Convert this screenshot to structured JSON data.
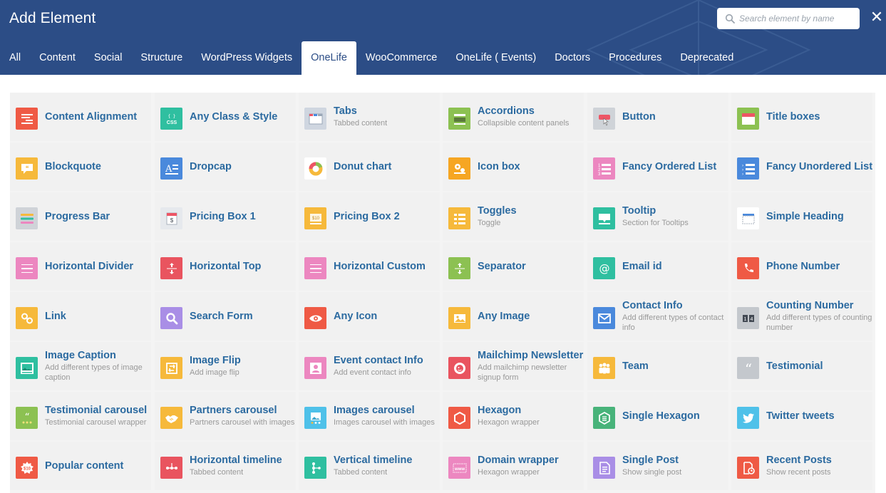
{
  "title": "Add Element",
  "search": {
    "placeholder": "Search element by name"
  },
  "close_label": "✕",
  "tabs": [
    "All",
    "Content",
    "Social",
    "Structure",
    "WordPress Widgets",
    "OneLife",
    "WooCommerce",
    "OneLife ( Events)",
    "Doctors",
    "Procedures",
    "Deprecated"
  ],
  "active_tab": "OneLife",
  "elements": [
    {
      "name": "Content Alignment",
      "desc": "",
      "icon": "align-icon",
      "color": "#ef5a45"
    },
    {
      "name": "Any Class & Style",
      "desc": "",
      "icon": "css-icon",
      "color": "#2fbfa0"
    },
    {
      "name": "Tabs",
      "desc": "Tabbed content",
      "icon": "tabs-icon",
      "color": "#cfd6e0"
    },
    {
      "name": "Accordions",
      "desc": "Collapsible content panels",
      "icon": "accordion-icon",
      "color": "#8cc152"
    },
    {
      "name": "Button",
      "desc": "",
      "icon": "button-icon",
      "color": "#cfd3d8"
    },
    {
      "name": "Title boxes",
      "desc": "",
      "icon": "title-box-icon",
      "color": "#8cc152"
    },
    {
      "name": "Blockquote",
      "desc": "",
      "icon": "quote-bubble-icon",
      "color": "#f6b93b"
    },
    {
      "name": "Dropcap",
      "desc": "",
      "icon": "dropcap-icon",
      "color": "#4a89dc"
    },
    {
      "name": "Donut chart",
      "desc": "",
      "icon": "donut-icon",
      "color": "#ffffff"
    },
    {
      "name": "Icon box",
      "desc": "",
      "icon": "gears-icon",
      "color": "#f6a623"
    },
    {
      "name": "Fancy Ordered List",
      "desc": "",
      "icon": "ordered-list-icon",
      "color": "#ec87c0"
    },
    {
      "name": "Fancy Unordered List",
      "desc": "",
      "icon": "unordered-list-icon",
      "color": "#4a89dc"
    },
    {
      "name": "Progress Bar",
      "desc": "",
      "icon": "progress-bar-icon",
      "color": "#cfd3d8"
    },
    {
      "name": "Pricing Box 1",
      "desc": "",
      "icon": "pricing-box-icon",
      "color": "#e6e9ed"
    },
    {
      "name": "Pricing Box 2",
      "desc": "",
      "icon": "price-tag-icon",
      "color": "#f6b93b"
    },
    {
      "name": "Toggles",
      "desc": "Toggle",
      "icon": "toggles-icon",
      "color": "#f6b93b"
    },
    {
      "name": "Tooltip",
      "desc": "Section for Tooltips",
      "icon": "tooltip-icon",
      "color": "#2fbfa0"
    },
    {
      "name": "Simple Heading",
      "desc": "",
      "icon": "heading-icon",
      "color": "#ffffff"
    },
    {
      "name": "Horizontal Divider",
      "desc": "",
      "icon": "divider-icon",
      "color": "#ec87c0"
    },
    {
      "name": "Horizontal Top",
      "desc": "",
      "icon": "arrows-vertical-icon",
      "color": "#e9545f"
    },
    {
      "name": "Horizontal Custom",
      "desc": "",
      "icon": "divider-icon",
      "color": "#ec87c0"
    },
    {
      "name": "Separator",
      "desc": "",
      "icon": "arrows-vertical-icon",
      "color": "#8cc152"
    },
    {
      "name": "Email id",
      "desc": "",
      "icon": "at-icon",
      "color": "#2fbfa0"
    },
    {
      "name": "Phone Number",
      "desc": "",
      "icon": "phone-icon",
      "color": "#ef5a45"
    },
    {
      "name": "Link",
      "desc": "",
      "icon": "link-icon",
      "color": "#f6b93b"
    },
    {
      "name": "Search Form",
      "desc": "",
      "icon": "search-icon",
      "color": "#a98ee6"
    },
    {
      "name": "Any Icon",
      "desc": "",
      "icon": "eye-icon",
      "color": "#ef5a45"
    },
    {
      "name": "Any Image",
      "desc": "",
      "icon": "image-icon",
      "color": "#f6b93b"
    },
    {
      "name": "Contact Info",
      "desc": "Add different types of contact info",
      "icon": "envelope-icon",
      "color": "#4a89dc"
    },
    {
      "name": "Counting Number",
      "desc": "Add different types of counting number",
      "icon": "counter-icon",
      "color": "#c4c8cd"
    },
    {
      "name": "Image Caption",
      "desc": "Add different types of image caption",
      "icon": "image-caption-icon",
      "color": "#2fbfa0"
    },
    {
      "name": "Image Flip",
      "desc": "Add image flip",
      "icon": "flip-icon",
      "color": "#f6b93b"
    },
    {
      "name": "Event contact Info",
      "desc": "Add event contact info",
      "icon": "contact-card-icon",
      "color": "#ec87c0"
    },
    {
      "name": "Mailchimp Newsletter",
      "desc": "Add mailchimp newsletter signup form",
      "icon": "mailchimp-icon",
      "color": "#e9545f"
    },
    {
      "name": "Team",
      "desc": "",
      "icon": "team-icon",
      "color": "#f6b93b"
    },
    {
      "name": "Testimonial",
      "desc": "",
      "icon": "quote-icon",
      "color": "#c4c8cd"
    },
    {
      "name": "Testimonial carousel",
      "desc": "Testimonial carousel wrapper",
      "icon": "quote-carousel-icon",
      "color": "#8cc152"
    },
    {
      "name": "Partners carousel",
      "desc": "Partners carousel with images",
      "icon": "handshake-icon",
      "color": "#f6b93b"
    },
    {
      "name": "Images carousel",
      "desc": "Images carousel with images",
      "icon": "image-carousel-icon",
      "color": "#4fc1e9"
    },
    {
      "name": "Hexagon",
      "desc": "Hexagon wrapper",
      "icon": "hexagon-icon",
      "color": "#ef5a45"
    },
    {
      "name": "Single Hexagon",
      "desc": "",
      "icon": "hexagon-lines-icon",
      "color": "#48b37a"
    },
    {
      "name": "Twitter tweets",
      "desc": "",
      "icon": "twitter-icon",
      "color": "#4fc1e9"
    },
    {
      "name": "Popular content",
      "desc": "",
      "icon": "badge-icon",
      "color": "#ef5a45"
    },
    {
      "name": "Horizontal timeline",
      "desc": "Tabbed content",
      "icon": "timeline-horizontal-icon",
      "color": "#e9545f"
    },
    {
      "name": "Vertical timeline",
      "desc": "Tabbed content",
      "icon": "timeline-vertical-icon",
      "color": "#2fbfa0"
    },
    {
      "name": "Domain wrapper",
      "desc": "Hexagon wrapper",
      "icon": "www-icon",
      "color": "#ec87c0"
    },
    {
      "name": "Single Post",
      "desc": "Show single post",
      "icon": "document-icon",
      "color": "#a98ee6"
    },
    {
      "name": "Recent Posts",
      "desc": "Show recent posts",
      "icon": "recent-doc-icon",
      "color": "#ef5a45"
    }
  ]
}
